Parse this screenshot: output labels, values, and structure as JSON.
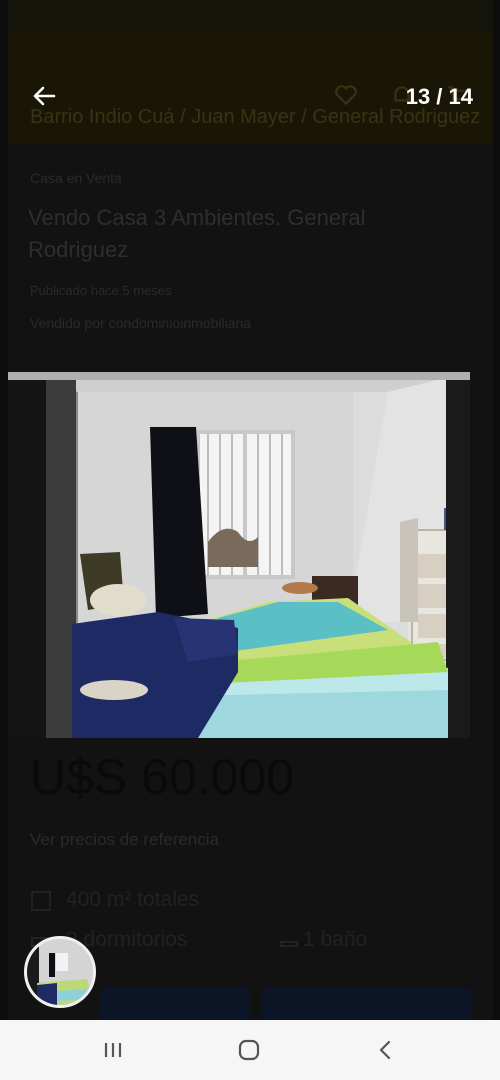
{
  "viewer": {
    "counter": "13 / 14"
  },
  "background_listing": {
    "location": "Barrio Indio Cuá / Juan Mayer / General Rodriguez",
    "breadcrumb": "Casa en Venta",
    "title": "Vendo Casa 3 Ambientes. General Rodriguez",
    "published": "Publicado hace 5 meses",
    "seller": "Vendido por condominioinmobiliaria",
    "price": "U$S 60.000",
    "reference_link": "Ver precios de referencia",
    "area": "400 m² totales",
    "bedrooms": "2 dormitorios",
    "bathrooms": "1 baño"
  },
  "colors": {
    "overlay": "#121212",
    "header_band": "#1a1606",
    "navbar": "#f6f6f6",
    "counter_text": "#ffffff"
  },
  "icons": {
    "back": "arrow-left-icon",
    "recents": "recents-icon",
    "home": "home-icon",
    "back_nav": "chevron-left-icon"
  }
}
